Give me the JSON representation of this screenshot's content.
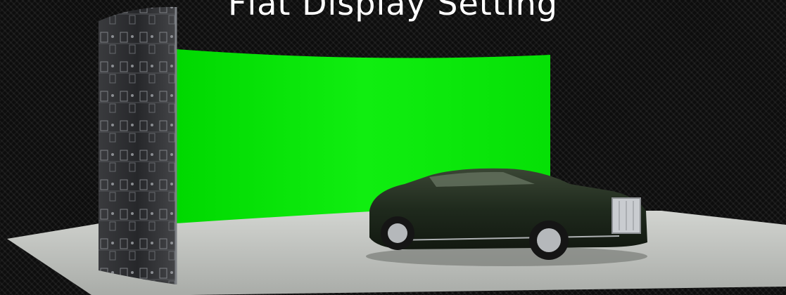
{
  "header": {
    "title": "Flat Display Setting"
  },
  "scene": {
    "floor_color": "#b9bcb8",
    "green_screen_color": "#00e600",
    "led_panel_color": "#2a2b2d",
    "car_body_color": "#1f2a1d"
  }
}
